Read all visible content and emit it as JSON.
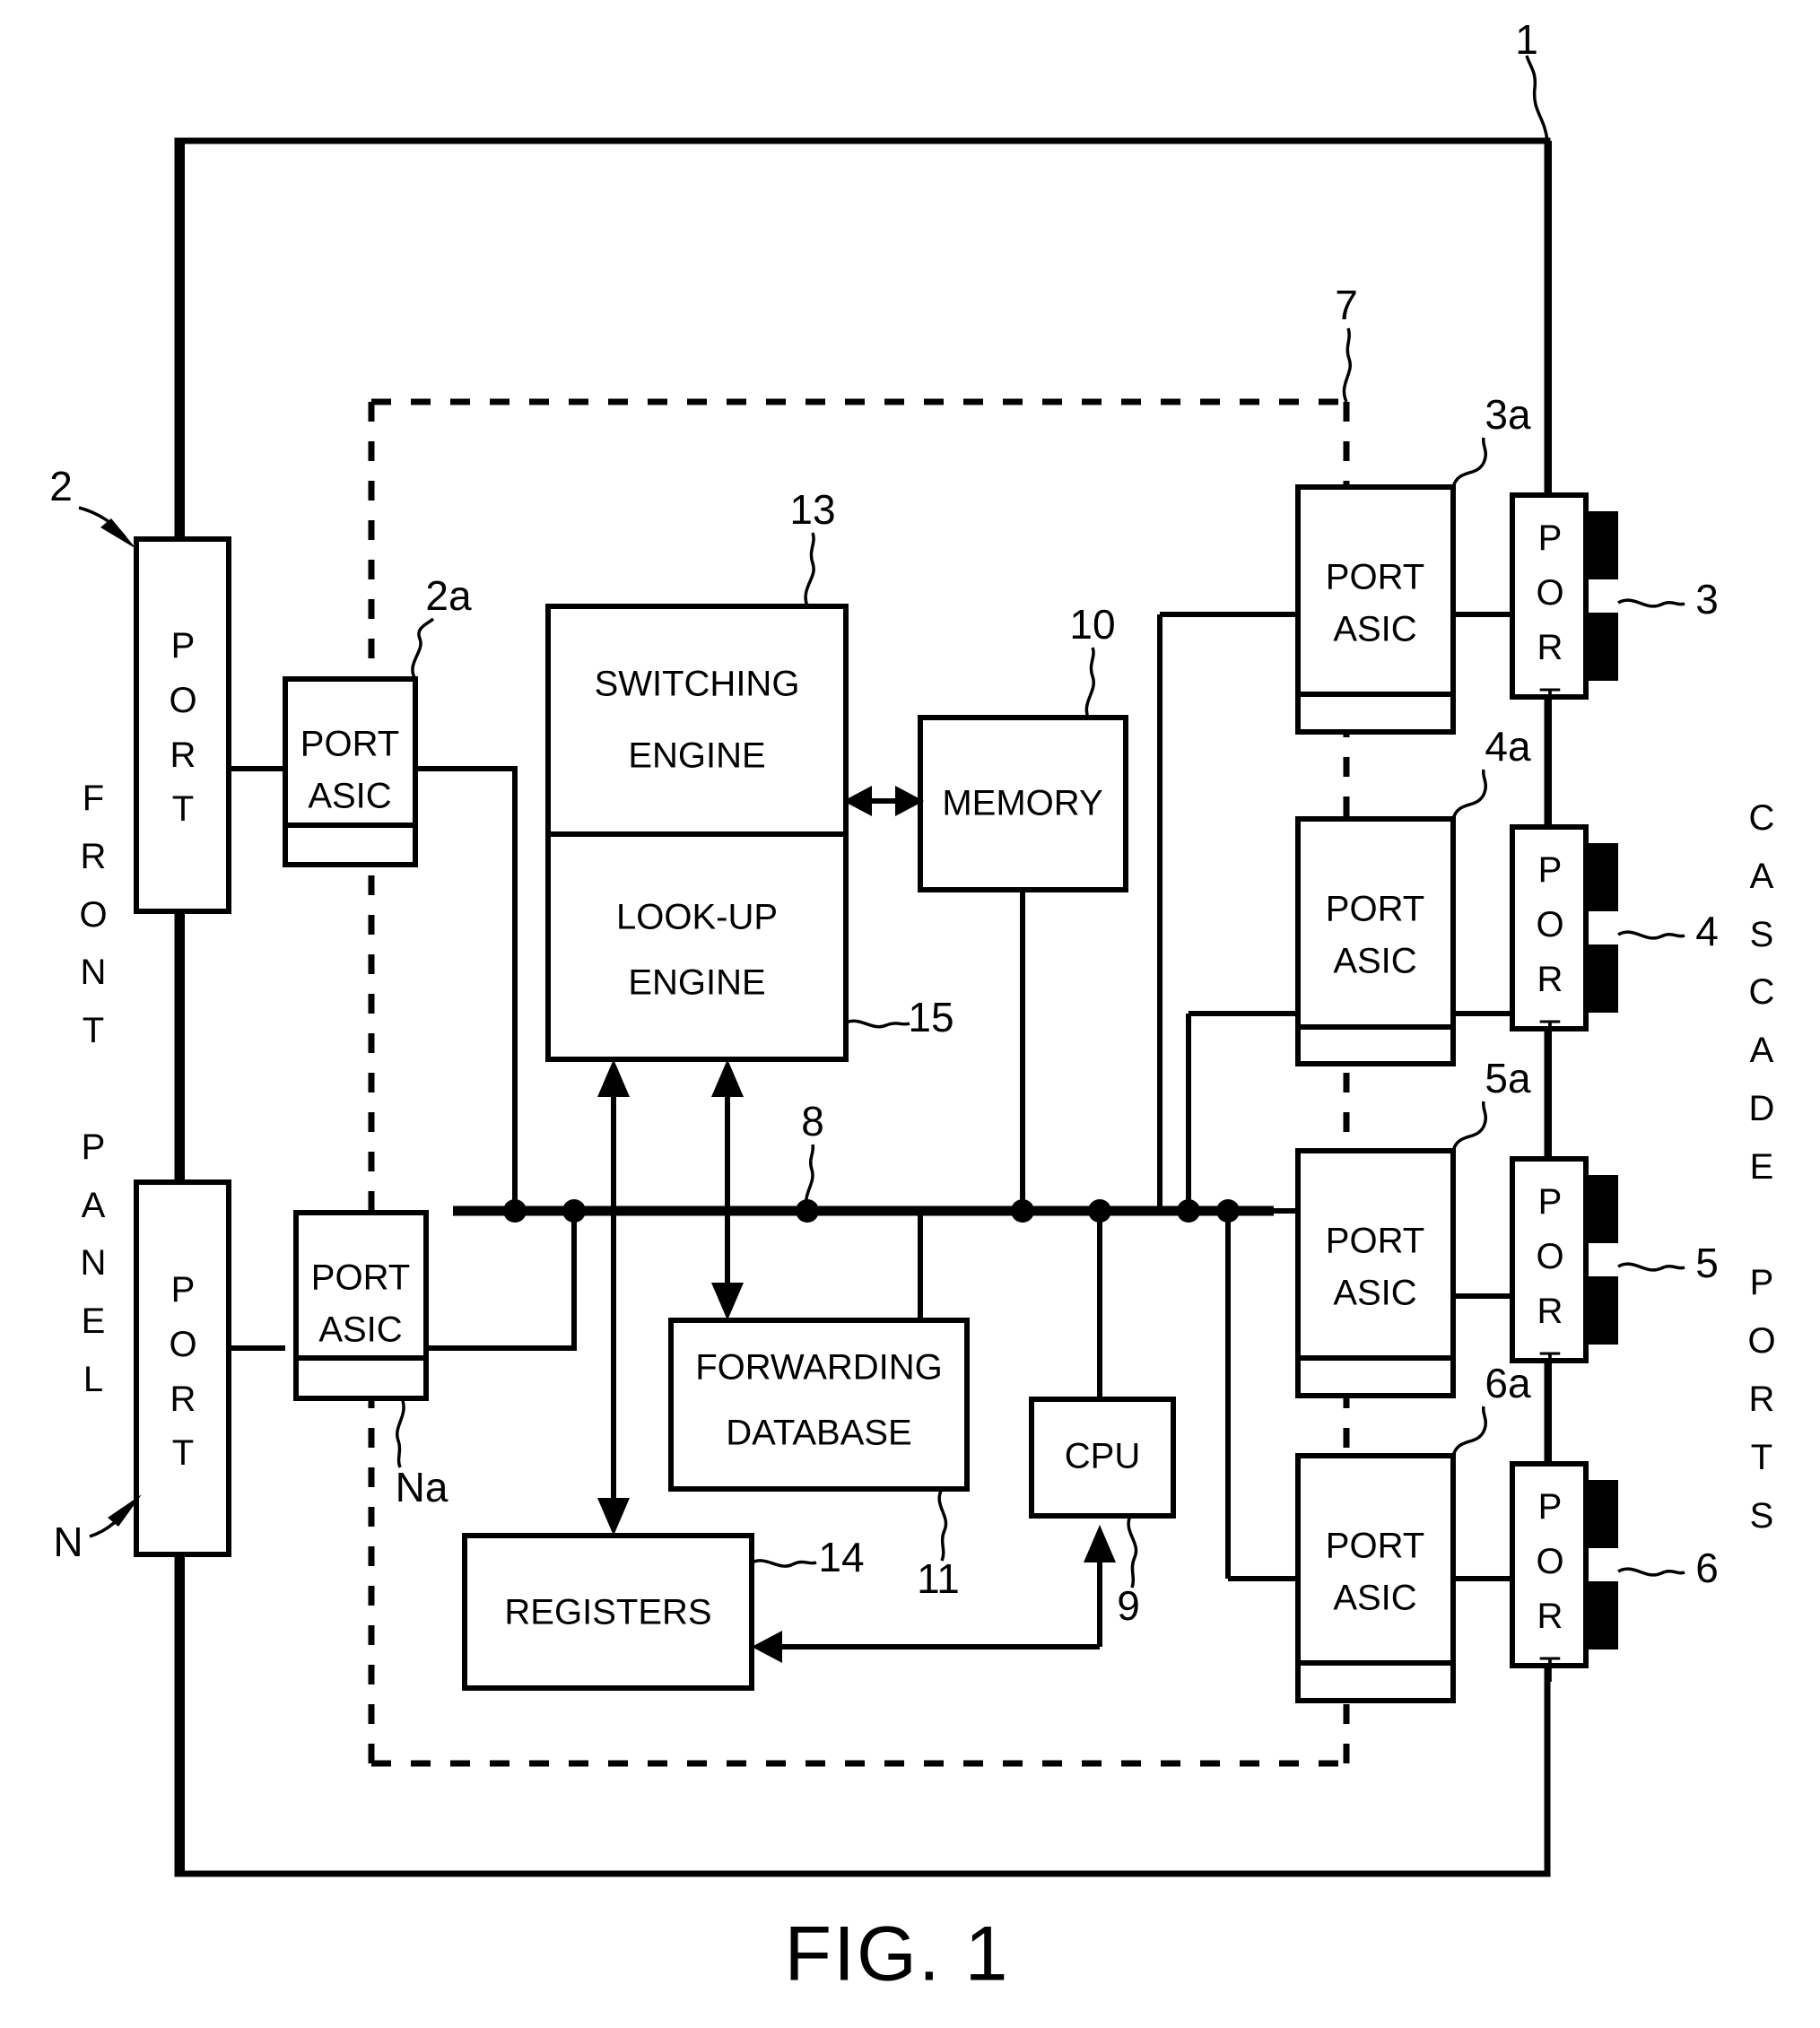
{
  "figure": {
    "caption": "FIG. 1",
    "reference_numerals": {
      "device": "1",
      "front_panel_port_first": "2",
      "front_panel_port_asic_first": "2a",
      "cascade_port_3": "3",
      "cascade_port_asic_3": "3a",
      "cascade_port_4": "4",
      "cascade_port_asic_4": "4a",
      "cascade_port_5": "5",
      "cascade_port_asic_5": "5a",
      "cascade_port_6": "6",
      "cascade_port_asic_6": "6a",
      "dashed_control_path": "7",
      "bus": "8",
      "cpu": "9",
      "memory": "10",
      "forwarding_database": "11",
      "switching_engine": "13",
      "registers": "14",
      "lookup_engine": "15",
      "front_panel_port_last": "N",
      "front_panel_port_asic_last": "Na"
    }
  },
  "side_labels": {
    "front_panel": "FRONT PANEL",
    "cascade_ports": "CASCADE PORTS"
  },
  "blocks": {
    "switching_engine": "SWITCHING ENGINE",
    "switching_engine_line1": "SWITCHING",
    "switching_engine_line2": "ENGINE",
    "lookup_engine_line1": "LOOK-UP",
    "lookup_engine_line2": "ENGINE",
    "memory": "MEMORY",
    "forwarding_db_line1": "FORWARDING",
    "forwarding_db_line2": "DATABASE",
    "cpu": "CPU",
    "registers": "REGISTERS",
    "port": "PORT",
    "port_asic_line1": "PORT",
    "port_asic_line2": "ASIC"
  },
  "front_panel_ports": [
    {
      "label": "PORT",
      "numeral": "2",
      "asic_label_line1": "PORT",
      "asic_label_line2": "ASIC",
      "asic_numeral": "2a"
    },
    {
      "label": "PORT",
      "numeral": "N",
      "asic_label_line1": "PORT",
      "asic_label_line2": "ASIC",
      "asic_numeral": "Na"
    }
  ],
  "cascade_ports": [
    {
      "label": "PORT",
      "numeral": "3",
      "asic_label_line1": "PORT",
      "asic_label_line2": "ASIC",
      "asic_numeral": "3a"
    },
    {
      "label": "PORT",
      "numeral": "4",
      "asic_label_line1": "PORT",
      "asic_label_line2": "ASIC",
      "asic_numeral": "4a"
    },
    {
      "label": "PORT",
      "numeral": "5",
      "asic_label_line1": "PORT",
      "asic_label_line2": "ASIC",
      "asic_numeral": "5a"
    },
    {
      "label": "PORT",
      "numeral": "6",
      "asic_label_line1": "PORT",
      "asic_label_line2": "ASIC",
      "asic_numeral": "6a"
    }
  ],
  "colors": {
    "ink": "#000000",
    "paper": "#ffffff"
  }
}
